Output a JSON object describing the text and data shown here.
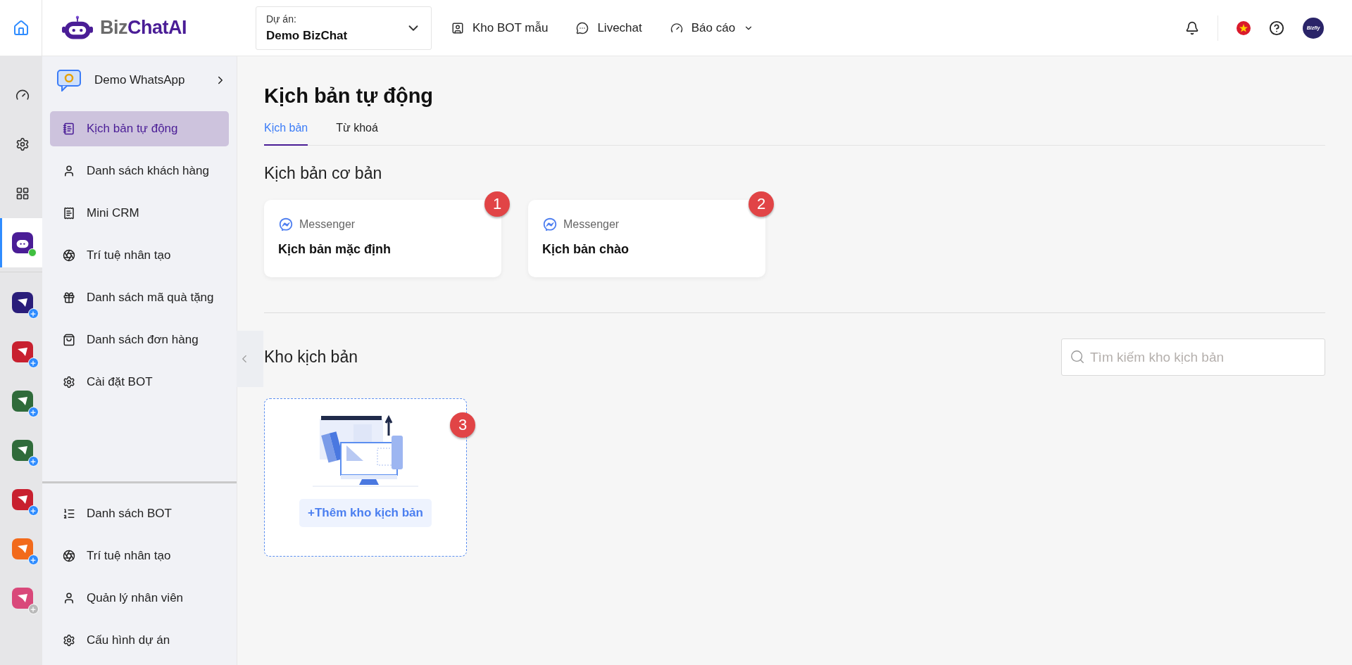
{
  "header": {
    "logo": {
      "part_1": "Biz",
      "part_2": "ChatAI"
    },
    "project": {
      "label": "Dự án:",
      "value": "Demo BizChat"
    },
    "nav": [
      {
        "label": "Kho BOT mẫu",
        "has_dropdown": false
      },
      {
        "label": "Livechat",
        "has_dropdown": false
      },
      {
        "label": "Báo cáo",
        "has_dropdown": true
      }
    ],
    "avatar": {
      "label": "Bizfly"
    }
  },
  "rail": {
    "items": [
      {
        "kind": "nav",
        "selected": false
      },
      {
        "kind": "nav",
        "selected": false
      },
      {
        "kind": "nav",
        "selected": false
      },
      {
        "kind": "bot",
        "selected": true,
        "online": true
      }
    ],
    "apps": [
      {
        "color": "#2a1d7a",
        "disabled": false
      },
      {
        "color": "#c8202f",
        "disabled": false
      },
      {
        "color": "#2f6b3a",
        "disabled": false
      },
      {
        "color": "#2f6b3a",
        "disabled": false
      },
      {
        "color": "#c8202f",
        "disabled": false
      },
      {
        "color": "#f26a1b",
        "disabled": false
      },
      {
        "color": "#d9487a",
        "disabled": true
      }
    ]
  },
  "sidebar": {
    "project": {
      "name": "Demo WhatsApp"
    },
    "items": [
      {
        "label": "Kịch bản tự động",
        "selected": true
      },
      {
        "label": "Danh sách khách hàng",
        "selected": false
      },
      {
        "label": "Mini CRM",
        "selected": false
      },
      {
        "label": "Trí tuệ nhân tạo",
        "selected": false
      },
      {
        "label": "Danh sách mã quà tặng",
        "selected": false
      },
      {
        "label": "Danh sách đơn hàng",
        "selected": false
      },
      {
        "label": "Cài đặt BOT",
        "selected": false
      }
    ],
    "bottom_items": [
      {
        "label": "Danh sách BOT",
        "selected": false
      },
      {
        "label": "Trí tuệ nhân tạo",
        "selected": false
      },
      {
        "label": "Quản lý nhân viên",
        "selected": false
      },
      {
        "label": "Cấu hình dự án",
        "selected": false
      }
    ]
  },
  "main": {
    "title": "Kịch bản tự động",
    "tabs": [
      {
        "label": "Kịch bản",
        "selected": true
      },
      {
        "label": "Từ khoá",
        "selected": false
      }
    ],
    "basic": {
      "title": "Kịch bản cơ bản",
      "cards": [
        {
          "channel": "Messenger",
          "name": "Kịch bản mặc định",
          "badge": "1"
        },
        {
          "channel": "Messenger",
          "name": "Kịch bản chào",
          "badge": "2"
        }
      ]
    },
    "library": {
      "title": "Kho kịch bản",
      "search": {
        "placeholder": "Tìm kiếm kho kịch bản"
      },
      "add_card": {
        "button": "+Thêm kho kịch bản",
        "badge": "3"
      }
    }
  }
}
